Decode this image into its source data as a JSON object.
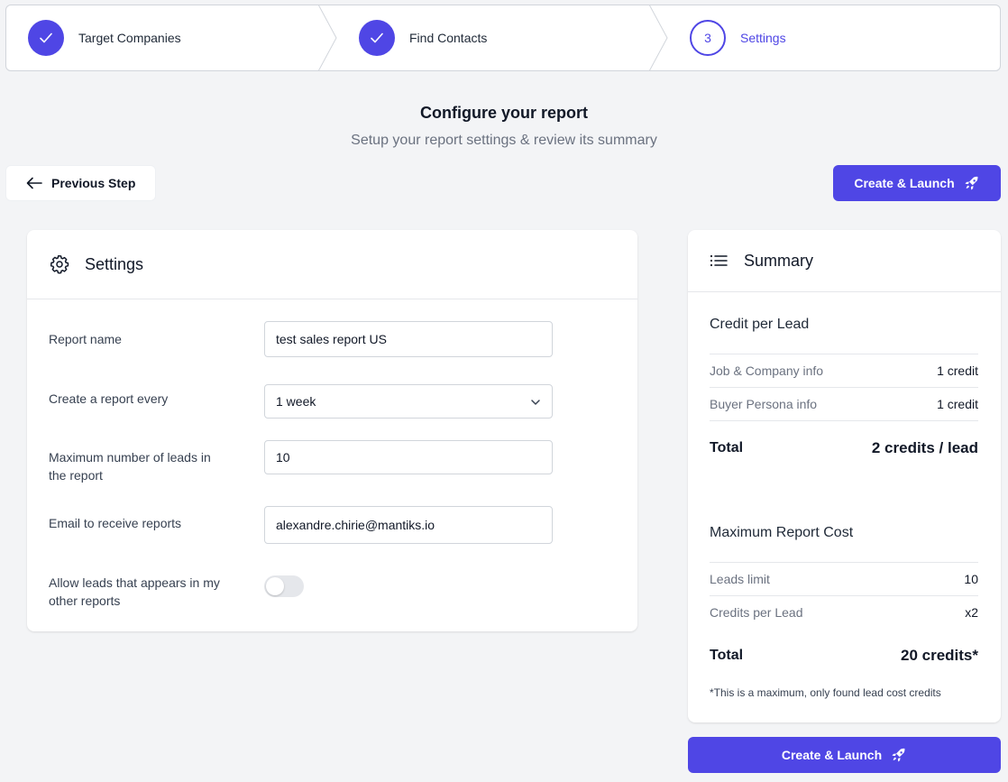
{
  "stepper": {
    "steps": [
      {
        "label": "Target Companies",
        "state": "done"
      },
      {
        "label": "Find Contacts",
        "state": "done"
      },
      {
        "label": "Settings",
        "number": "3",
        "state": "current"
      }
    ]
  },
  "header": {
    "title": "Configure your report",
    "subtitle": "Setup your report settings & review its summary"
  },
  "actions": {
    "previous_label": "Previous Step",
    "create_label": "Create & Launch"
  },
  "settings": {
    "title": "Settings",
    "fields": {
      "report_name": {
        "label": "Report name",
        "value": "test sales report US"
      },
      "frequency": {
        "label": "Create a report every",
        "value": "1 week"
      },
      "max_leads": {
        "label": "Maximum number of leads in the report",
        "value": "10"
      },
      "email": {
        "label": "Email to receive reports",
        "value": "alexandre.chirie@mantiks.io"
      },
      "allow_dupes": {
        "label": "Allow leads that appears in my other reports",
        "value": false
      }
    }
  },
  "summary": {
    "title": "Summary",
    "credit_per_lead": {
      "title": "Credit per Lead",
      "rows": [
        {
          "key": "Job & Company info",
          "value": "1 credit"
        },
        {
          "key": "Buyer Persona info",
          "value": "1 credit"
        }
      ],
      "total_label": "Total",
      "total_value": "2 credits / lead"
    },
    "max_cost": {
      "title": "Maximum Report Cost",
      "rows": [
        {
          "key": "Leads limit",
          "value": "10"
        },
        {
          "key": "Credits per Lead",
          "value": "x2"
        }
      ],
      "total_label": "Total",
      "total_value": "20 credits*"
    },
    "note": "*This is a maximum, only found lead cost credits"
  },
  "colors": {
    "accent": "#4f46e5",
    "background": "#f3f4f6"
  }
}
